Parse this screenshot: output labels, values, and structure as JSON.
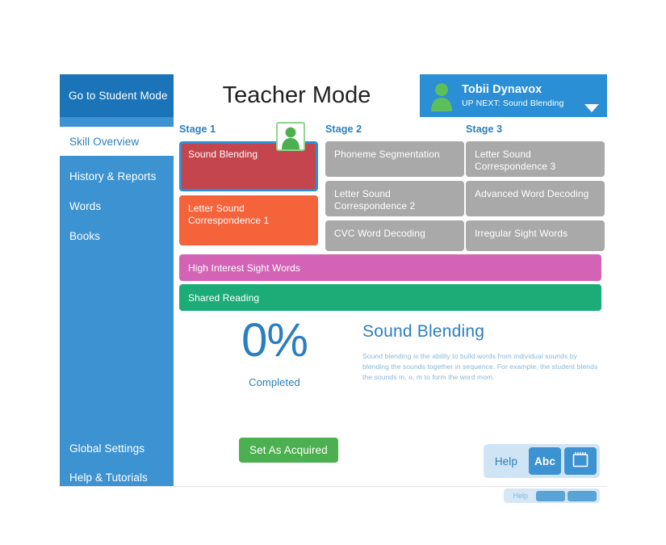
{
  "window": {
    "topbar": {
      "student_mode_label": "Go to Student Mode",
      "title": "Teacher Mode",
      "user": {
        "name": "Tobii Dynavox",
        "up_next": "UP NEXT: Sound Blending",
        "avatar_icon": "person-icon",
        "caret_icon": "chevron-down-icon"
      }
    },
    "sidebar": {
      "top_items": [
        {
          "label": "Skill Overview",
          "active": true
        },
        {
          "label": "History & Reports",
          "active": false
        },
        {
          "label": "Words",
          "active": false
        },
        {
          "label": "Books",
          "active": false
        }
      ],
      "bottom_items": [
        {
          "label": "Global Settings"
        },
        {
          "label": "Help & Tutorials"
        }
      ]
    },
    "main": {
      "stages": [
        {
          "label": "Stage 1",
          "cards": [
            {
              "title": "Sound Blending",
              "state": "current",
              "color": "#c4454e"
            },
            {
              "title": "Letter Sound Correspondence 1",
              "state": "in-progress",
              "color": "#f4633a"
            }
          ]
        },
        {
          "label": "Stage 2",
          "cards": [
            {
              "title": "Phoneme Segmentation",
              "state": "locked",
              "color": "#a9a9a9"
            },
            {
              "title": "Letter Sound Correspondence 2",
              "state": "locked",
              "color": "#a9a9a9"
            },
            {
              "title": "CVC Word Decoding",
              "state": "locked",
              "color": "#a9a9a9"
            }
          ]
        },
        {
          "label": "Stage 3",
          "cards": [
            {
              "title": "Letter Sound Correspondence 3",
              "state": "locked",
              "color": "#a9a9a9"
            },
            {
              "title": "Advanced Word Decoding",
              "state": "locked",
              "color": "#a9a9a9"
            },
            {
              "title": "Irregular Sight Words",
              "state": "locked",
              "color": "#a9a9a9"
            }
          ]
        }
      ],
      "learner_marker_icon": "person-icon",
      "wide_bars": [
        {
          "title": "High Interest Sight Words",
          "color": "#d364b5"
        },
        {
          "title": "Shared Reading",
          "color": "#1cac77"
        }
      ],
      "detail": {
        "percent": "0%",
        "percent_caption": "Completed",
        "skill_title": "Sound Blending",
        "skill_description": "Sound blending is the ability to build words from individual sounds by blending the sounds together in sequence. For example, the student blends the sounds m, o, m to form the word mom."
      },
      "footer": {
        "set_acquired_label": "Set As Acquired",
        "help_label": "Help",
        "abc_button_label": "Abc",
        "notebook_button_icon": "notebook-icon"
      }
    }
  },
  "colors": {
    "accent_blue": "#2a7fc0",
    "sidebar_blue": "#3d93d1",
    "header_blue": "#1b73b8",
    "chip_blue": "#2a8fd4",
    "green_button": "#4caf50",
    "locked_gray": "#a9a9a9"
  }
}
